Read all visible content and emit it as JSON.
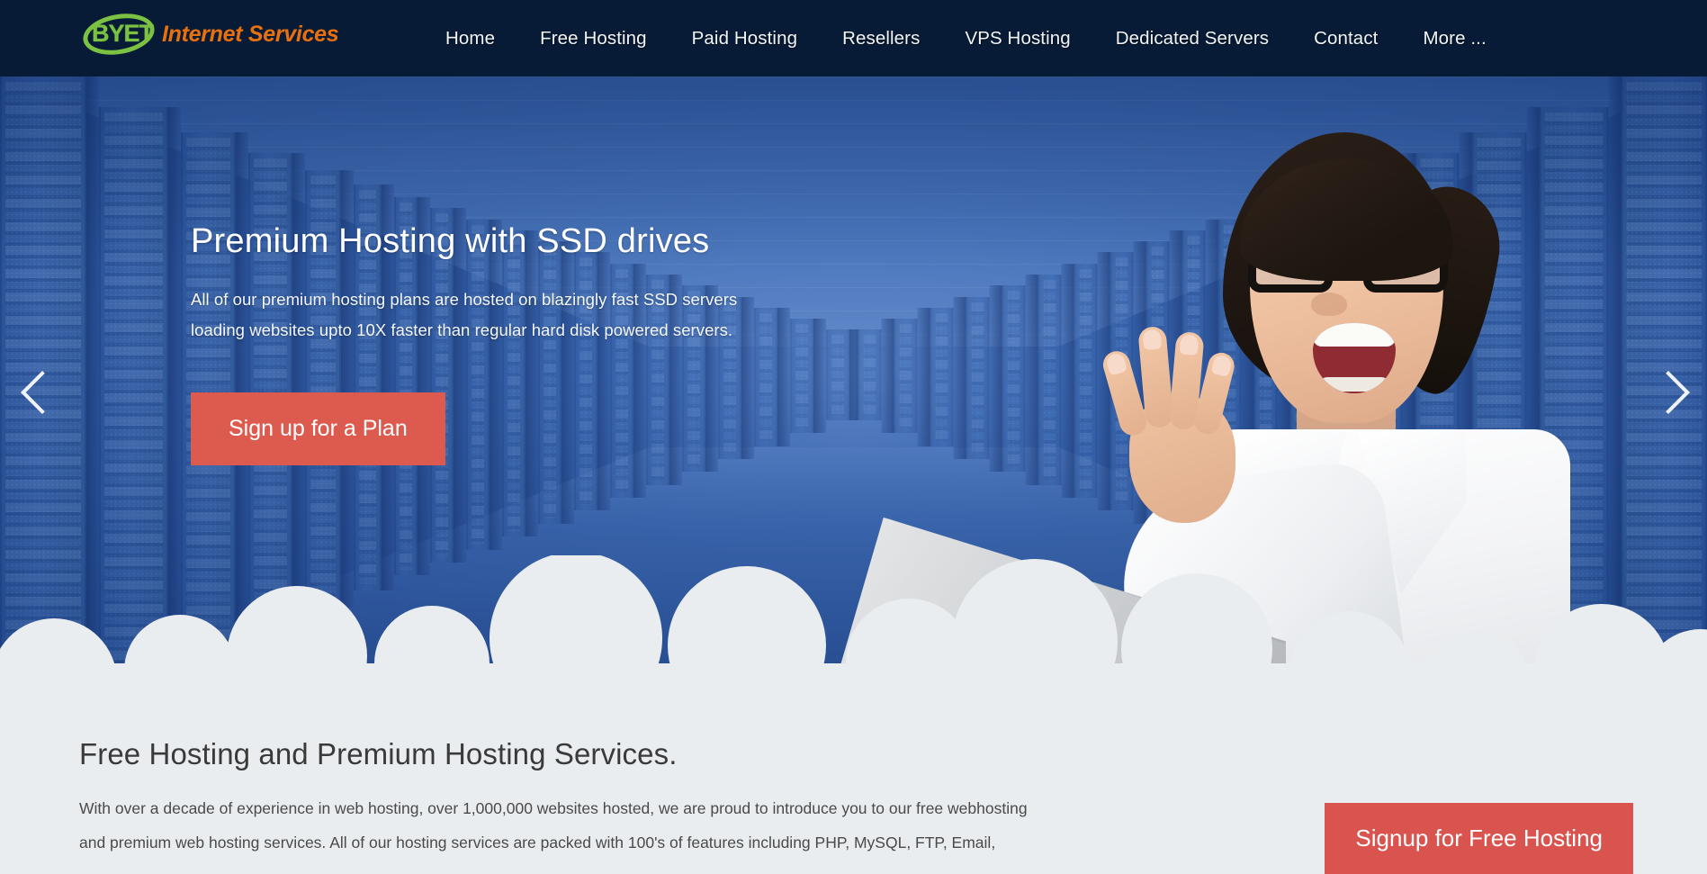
{
  "header": {
    "logo": {
      "mark_text": "BYET",
      "wordmark": "Internet Services",
      "green": "#7cc242",
      "orange": "#e8700e"
    },
    "nav": [
      {
        "label": "Home"
      },
      {
        "label": "Free Hosting"
      },
      {
        "label": "Paid Hosting"
      },
      {
        "label": "Resellers"
      },
      {
        "label": "VPS Hosting"
      },
      {
        "label": "Dedicated Servers"
      },
      {
        "label": "Contact"
      },
      {
        "label": "More ..."
      }
    ],
    "background": "#071b36"
  },
  "hero": {
    "title": "Premium Hosting with SSD drives",
    "line1": "All of our premium hosting plans are hosted on blazingly fast SSD servers",
    "line2": "loading websites upto 10X faster than regular hard disk powered servers.",
    "cta_label": "Sign up for a Plan",
    "cta_color": "#dd5a4f",
    "prev_icon": "chevron-left-icon",
    "next_icon": "chevron-right-icon",
    "background_color": "#2f5da8"
  },
  "content": {
    "title": "Free Hosting and Premium Hosting Services.",
    "paragraph_line1": "With over a decade of experience in web hosting, over 1,000,000 websites hosted, we are proud to introduce you to our free webhosting",
    "paragraph_line2": "and premium web hosting services. All of our hosting services are packed with 100's of features including PHP, MySQL, FTP, Email,",
    "signup_label": "Signup for Free Hosting",
    "signup_color": "#d9534f",
    "background": "#eaedef"
  }
}
